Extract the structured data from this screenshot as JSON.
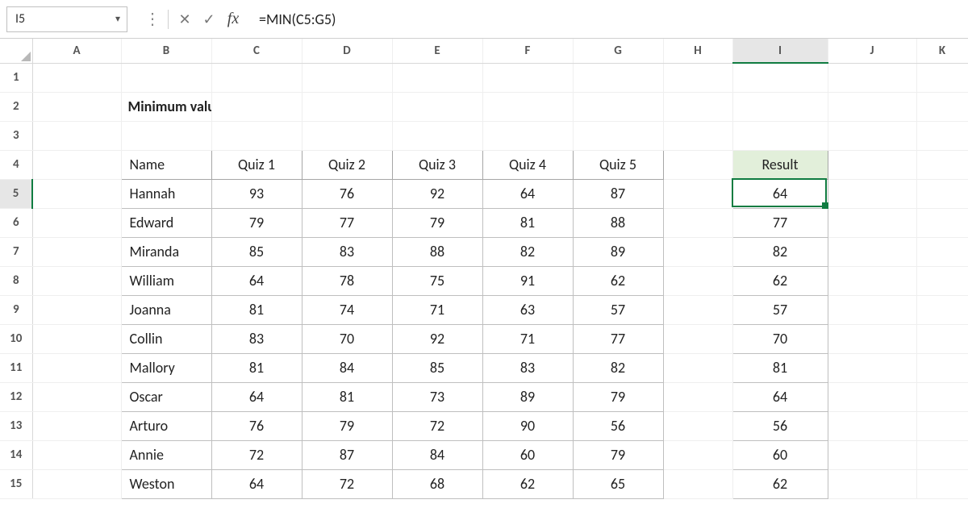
{
  "namebox": "I5",
  "formula": "=MIN(C5:G5)",
  "columns": [
    "A",
    "B",
    "C",
    "D",
    "E",
    "F",
    "G",
    "H",
    "I",
    "J",
    "K"
  ],
  "selected_col": "I",
  "selected_row": 5,
  "title": "Minimum value",
  "table": {
    "headers": [
      "Name",
      "Quiz 1",
      "Quiz 2",
      "Quiz 3",
      "Quiz 4",
      "Quiz 5"
    ],
    "result_header": "Result",
    "rows": [
      {
        "name": "Hannah",
        "q": [
          93,
          76,
          92,
          64,
          87
        ],
        "result": 64
      },
      {
        "name": "Edward",
        "q": [
          79,
          77,
          79,
          81,
          88
        ],
        "result": 77
      },
      {
        "name": "Miranda",
        "q": [
          85,
          83,
          88,
          82,
          89
        ],
        "result": 82
      },
      {
        "name": "William",
        "q": [
          64,
          78,
          75,
          91,
          62
        ],
        "result": 62
      },
      {
        "name": "Joanna",
        "q": [
          81,
          74,
          71,
          63,
          57
        ],
        "result": 57
      },
      {
        "name": "Collin",
        "q": [
          83,
          70,
          92,
          71,
          77
        ],
        "result": 70
      },
      {
        "name": "Mallory",
        "q": [
          81,
          84,
          85,
          83,
          82
        ],
        "result": 81
      },
      {
        "name": "Oscar",
        "q": [
          64,
          81,
          73,
          89,
          79
        ],
        "result": 64
      },
      {
        "name": "Arturo",
        "q": [
          76,
          79,
          72,
          90,
          56
        ],
        "result": 56
      },
      {
        "name": "Annie",
        "q": [
          72,
          87,
          84,
          60,
          79
        ],
        "result": 60
      },
      {
        "name": "Weston",
        "q": [
          64,
          72,
          68,
          62,
          65
        ],
        "result": 62
      }
    ]
  },
  "chart_data": {
    "type": "table",
    "title": "Minimum value",
    "columns": [
      "Name",
      "Quiz 1",
      "Quiz 2",
      "Quiz 3",
      "Quiz 4",
      "Quiz 5",
      "Result"
    ],
    "rows": [
      [
        "Hannah",
        93,
        76,
        92,
        64,
        87,
        64
      ],
      [
        "Edward",
        79,
        77,
        79,
        81,
        88,
        77
      ],
      [
        "Miranda",
        85,
        83,
        88,
        82,
        89,
        82
      ],
      [
        "William",
        64,
        78,
        75,
        91,
        62,
        62
      ],
      [
        "Joanna",
        81,
        74,
        71,
        63,
        57,
        57
      ],
      [
        "Collin",
        83,
        70,
        92,
        71,
        77,
        70
      ],
      [
        "Mallory",
        81,
        84,
        85,
        83,
        82,
        81
      ],
      [
        "Oscar",
        64,
        81,
        73,
        89,
        79,
        64
      ],
      [
        "Arturo",
        76,
        79,
        72,
        90,
        56,
        56
      ],
      [
        "Annie",
        72,
        87,
        84,
        60,
        79,
        60
      ],
      [
        "Weston",
        64,
        72,
        68,
        62,
        65,
        62
      ]
    ]
  }
}
